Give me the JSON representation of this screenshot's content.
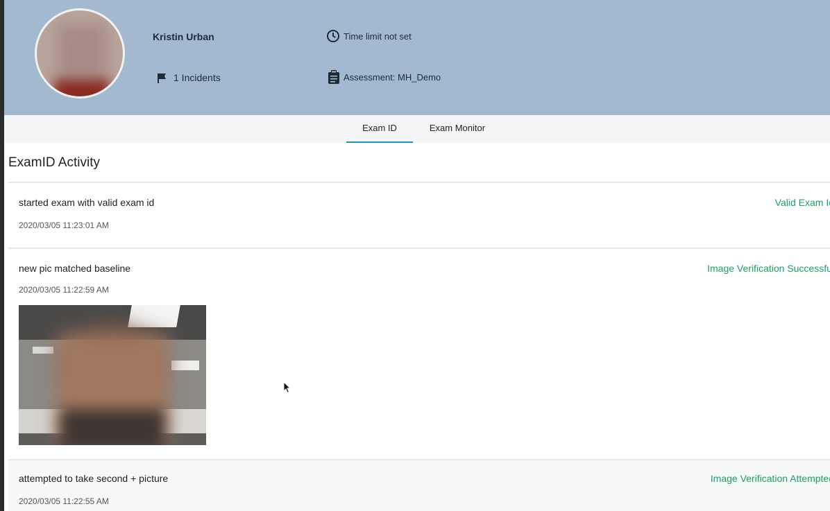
{
  "header": {
    "name": "Kristin Urban",
    "incidents": "1 Incidents",
    "time_limit": "Time limit not set",
    "assessment": "Assessment: MH_Demo"
  },
  "tabs": [
    {
      "label": "Exam ID",
      "active": true
    },
    {
      "label": "Exam Monitor",
      "active": false
    }
  ],
  "section": {
    "title": "ExamID Activity"
  },
  "activity": [
    {
      "description": "started exam with valid exam id",
      "timestamp": "2020/03/05 11:23:01 AM",
      "status": "Valid Exam Id"
    },
    {
      "description": "new pic matched baseline",
      "timestamp": "2020/03/05 11:22:59 AM",
      "status": "Image Verification Successful"
    },
    {
      "description": "attempted to take second + picture",
      "timestamp": "2020/03/05 11:22:55 AM",
      "status": "Image Verification Attempted"
    }
  ],
  "colors": {
    "header_bg": "#a3b9cf",
    "status_green": "#1aa064",
    "tab_underline": "#1f8fc7"
  },
  "icons": [
    "clock-icon",
    "flag-icon",
    "clipboard-icon"
  ]
}
